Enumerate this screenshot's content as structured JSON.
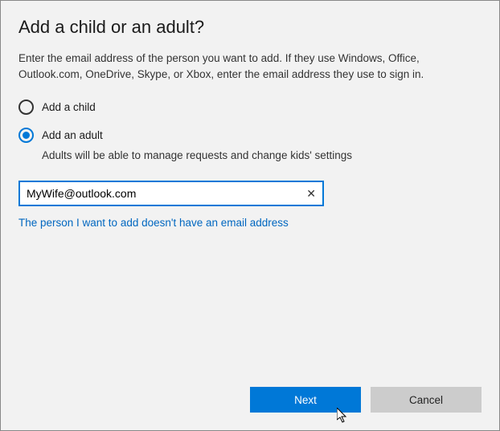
{
  "title": "Add a child or an adult?",
  "description": "Enter the email address of the person you want to add. If they use Windows, Office, Outlook.com, OneDrive, Skype, or Xbox, enter the email address they use to sign in.",
  "radios": {
    "child": {
      "label": "Add a child",
      "selected": false
    },
    "adult": {
      "label": "Add an adult",
      "selected": true,
      "sub": "Adults will be able to manage requests and change kids' settings"
    }
  },
  "email": {
    "value": "MyWife@outlook.com",
    "placeholder": ""
  },
  "link": "The person I want to add doesn't have an email address",
  "buttons": {
    "next": "Next",
    "cancel": "Cancel"
  }
}
